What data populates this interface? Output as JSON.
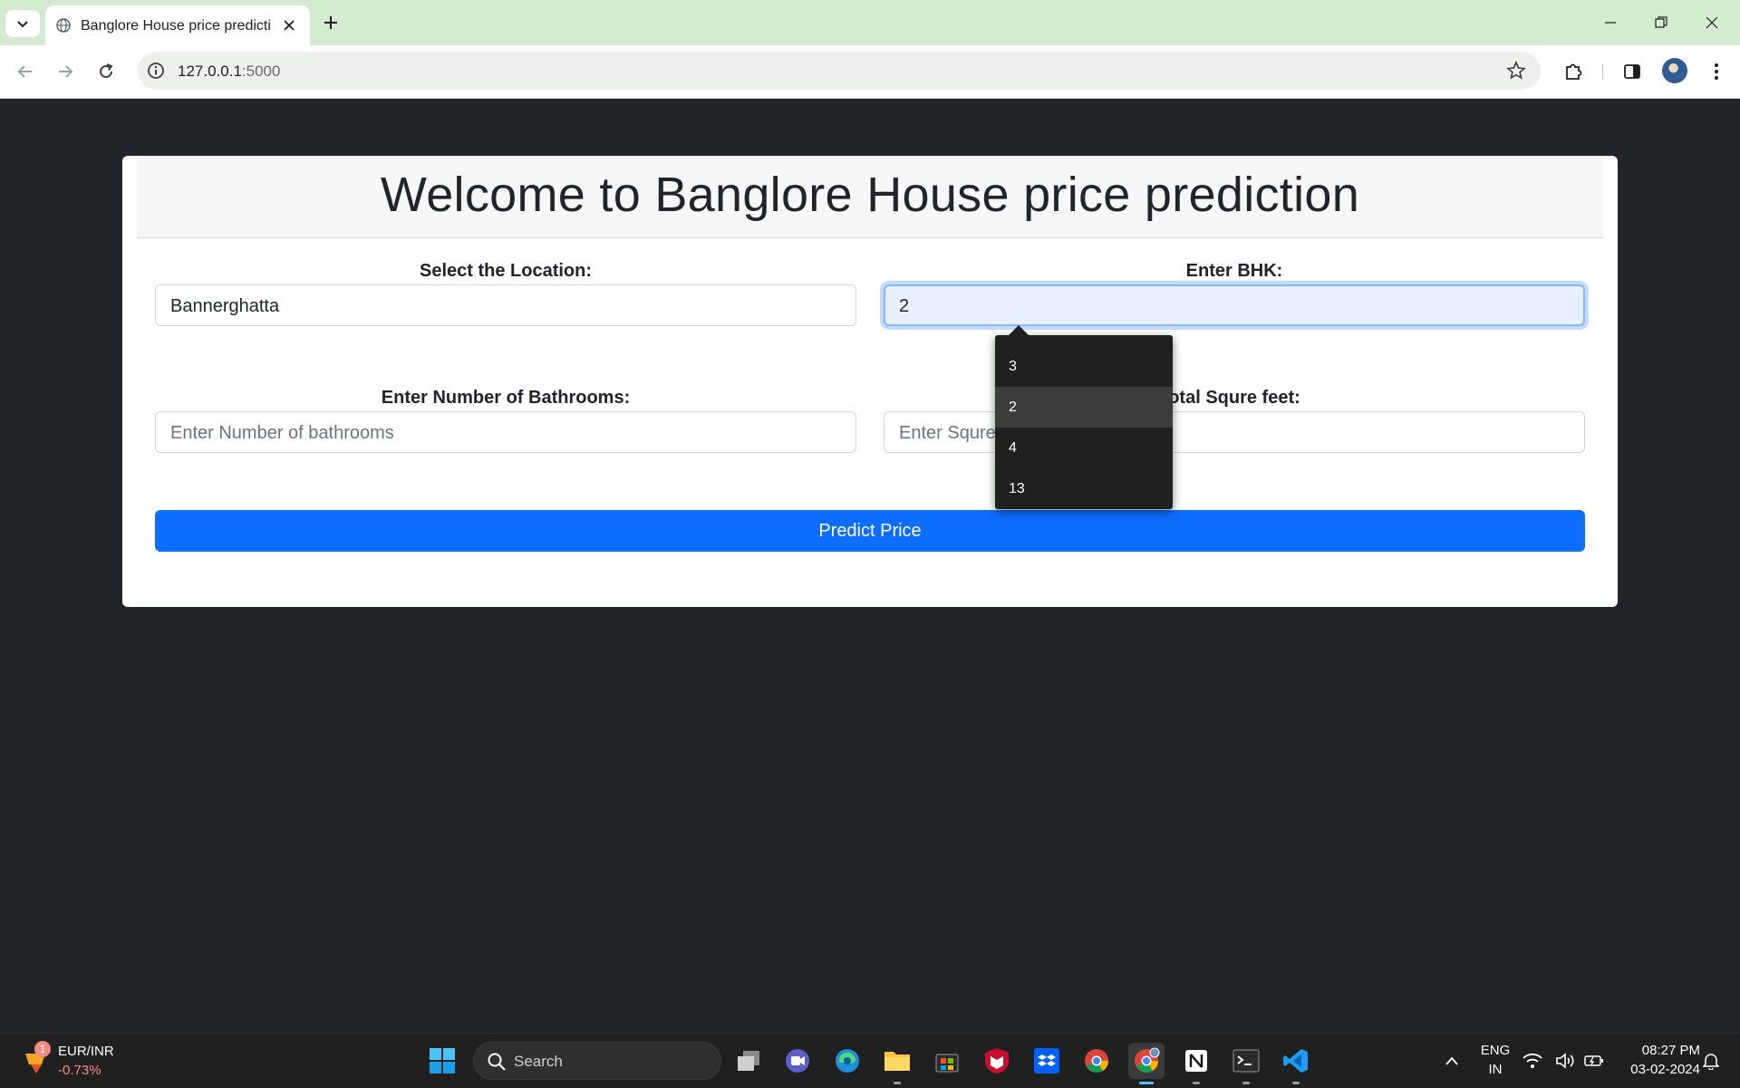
{
  "browser": {
    "tab_title": "Banglore House price predictio",
    "url_host": "127.0.0.1",
    "url_port": ":5000"
  },
  "page": {
    "heading": "Welcome to Banglore House price prediction",
    "location": {
      "label": "Select the Location:",
      "value": "Bannerghatta"
    },
    "bhk": {
      "label": "Enter BHK:",
      "value": "2"
    },
    "bathrooms": {
      "label": "Enter Number of Bathrooms:",
      "placeholder": "Enter Number of bathrooms"
    },
    "sqft": {
      "label": "otal Squre feet:",
      "placeholder": "Enter Squre"
    },
    "predict_button": "Predict Price",
    "bhk_suggestions": [
      "3",
      "2",
      "4",
      "13"
    ],
    "highlighted_suggestion": "2"
  },
  "taskbar": {
    "widget_badge": "1",
    "ticker_name": "EUR/INR",
    "ticker_change": "-0.73%",
    "search_label": "Search",
    "language": "ENG",
    "region": "IN",
    "time": "08:27 PM",
    "date": "03-02-2024"
  },
  "colors": {
    "page_bg": "#212529",
    "primary_button": "#0d6efd",
    "titlebar": "#d3ebcf",
    "ticker_negative": "#f28b82"
  }
}
